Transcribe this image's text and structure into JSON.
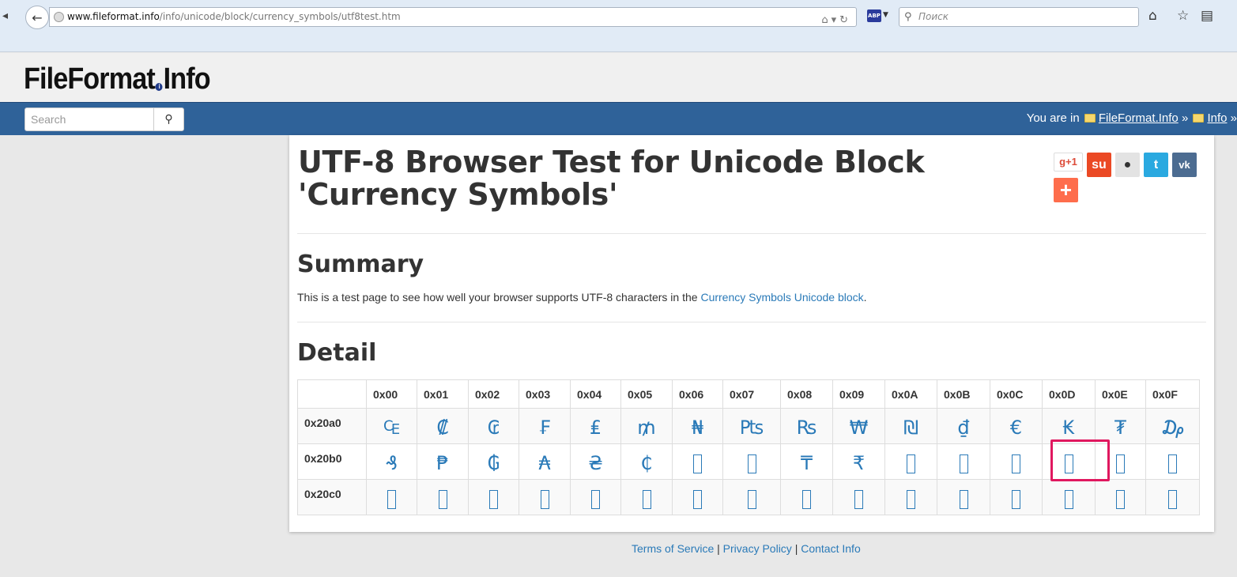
{
  "browser": {
    "url_host": "www.fileformat.info",
    "url_path": "/info/unicode/block/currency_symbols/utf8test.htm",
    "search_placeholder": "Поиск"
  },
  "site": {
    "logo_left": "FileFormat",
    "logo_right": "Info",
    "search_placeholder": "Search",
    "breadcrumb_prefix": "You are in",
    "breadcrumb_items": [
      "FileFormat.Info",
      "Info"
    ],
    "breadcrumb_sep": "»"
  },
  "page": {
    "title": "UTF-8 Browser Test for Unicode Block 'Currency Symbols'",
    "summary_heading": "Summary",
    "summary_text": "This is a test page to see how well your browser supports UTF-8 characters in the",
    "summary_link": "Currency Symbols Unicode block",
    "summary_end": ".",
    "detail_heading": "Detail"
  },
  "share_buttons": [
    {
      "icon": "google-plus-icon",
      "label": "g+1",
      "color": "#ffffff"
    },
    {
      "icon": "stumbleupon-icon",
      "label": "su",
      "color": "#eb4924"
    },
    {
      "icon": "reddit-icon",
      "label": "●",
      "color": "#cee3f8"
    },
    {
      "icon": "twitter-icon",
      "label": "t",
      "color": "#2aa9e0"
    },
    {
      "icon": "vk-icon",
      "label": "vk",
      "color": "#4c6c91"
    },
    {
      "icon": "addthis-icon",
      "label": "+",
      "color": "#fe6d4c"
    }
  ],
  "table": {
    "columns": [
      "0x00",
      "0x01",
      "0x02",
      "0x03",
      "0x04",
      "0x05",
      "0x06",
      "0x07",
      "0x08",
      "0x09",
      "0x0A",
      "0x0B",
      "0x0C",
      "0x0D",
      "0x0E",
      "0x0F"
    ],
    "rows": [
      {
        "label": "0x20a0",
        "cells": [
          "₠",
          "₡",
          "₢",
          "₣",
          "₤",
          "₥",
          "₦",
          "₧",
          "₨",
          "₩",
          "₪",
          "₫",
          "€",
          "₭",
          "₮",
          "₯"
        ]
      },
      {
        "label": "0x20b0",
        "cells": [
          "₰",
          "₱",
          "₲",
          "₳",
          "₴",
          "₵",
          "",
          "",
          "₸",
          "₹",
          "",
          "",
          "",
          "",
          "",
          ""
        ]
      },
      {
        "label": "0x20c0",
        "cells": [
          "",
          "",
          "",
          "",
          "",
          "",
          "",
          "",
          "",
          "",
          "",
          "",
          "",
          "",
          "",
          ""
        ]
      }
    ]
  },
  "footer": {
    "links": [
      "Terms of Service",
      "Privacy Policy",
      "Contact Info"
    ],
    "sep": "|"
  },
  "colors": {
    "nav": "#2f6299",
    "link": "#2a7ab8",
    "highlight": "#e0185f"
  }
}
